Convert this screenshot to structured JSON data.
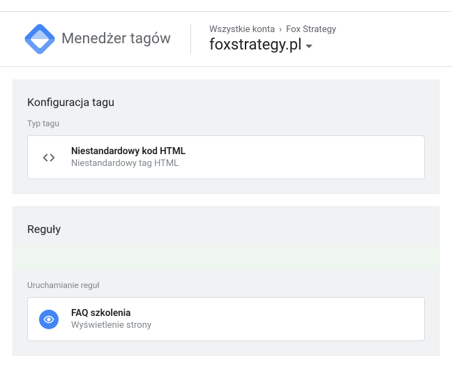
{
  "header": {
    "brand": "Menedżer tagów",
    "breadcrumb_all": "Wszystkie konta",
    "breadcrumb_account": "Fox Strategy",
    "container": "foxstrategy.pl"
  },
  "config_panel": {
    "title": "Konfiguracja tagu",
    "type_label": "Typ tagu",
    "tag_type_title": "Niestandardowy kod HTML",
    "tag_type_subtitle": "Niestandardowy tag HTML"
  },
  "triggers_panel": {
    "title": "Reguły",
    "firing_label": "Uruchamianie reguł",
    "trigger_title": "FAQ szkolenia",
    "trigger_subtitle": "Wyświetlenie strony"
  }
}
